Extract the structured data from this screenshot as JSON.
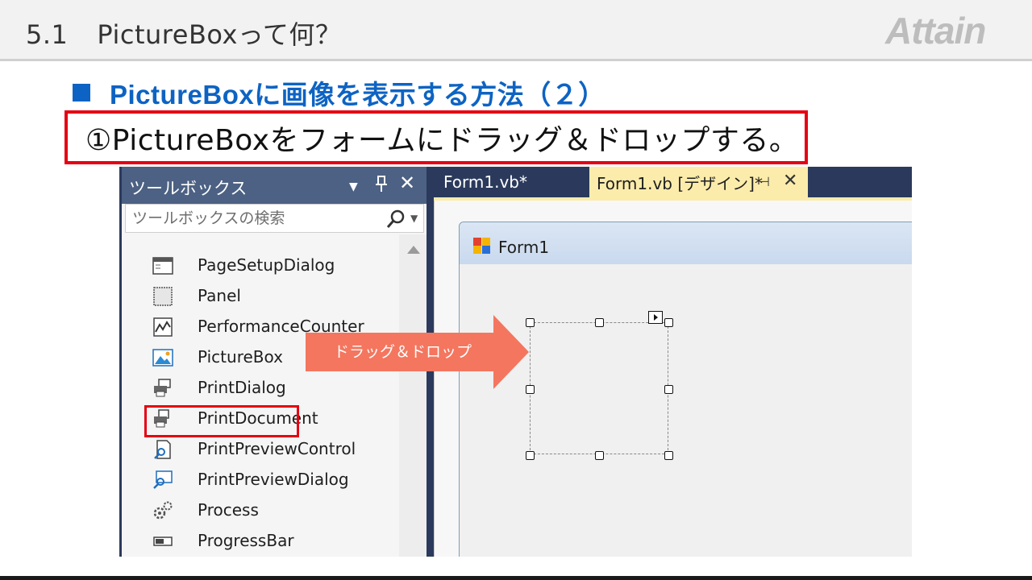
{
  "slide": {
    "number": "5.1",
    "title": "PictureBoxって何？",
    "logo_text": "Attain"
  },
  "section": {
    "heading": "PictureBoxに画像を表示する方法（２）"
  },
  "step": {
    "text": "①PictureBoxをフォームにドラッグ＆ドロップする。"
  },
  "toolbox": {
    "title": "ツールボックス",
    "search_placeholder": "ツールボックスの検索",
    "items": [
      {
        "label": "PageSetupDialog",
        "icon": "page-setup-icon"
      },
      {
        "label": "Panel",
        "icon": "panel-icon"
      },
      {
        "label": "PerformanceCounter",
        "icon": "performance-counter-icon"
      },
      {
        "label": "PictureBox",
        "icon": "picturebox-icon"
      },
      {
        "label": "PrintDialog",
        "icon": "print-dialog-icon"
      },
      {
        "label": "PrintDocument",
        "icon": "print-document-icon"
      },
      {
        "label": "PrintPreviewControl",
        "icon": "print-preview-control-icon"
      },
      {
        "label": "PrintPreviewDialog",
        "icon": "print-preview-dialog-icon"
      },
      {
        "label": "Process",
        "icon": "process-icon"
      },
      {
        "label": "ProgressBar",
        "icon": "progressbar-icon"
      }
    ]
  },
  "tabs": {
    "code_tab": "Form1.vb*",
    "design_tab": "Form1.vb [デザイン]*"
  },
  "form": {
    "title": "Form1"
  },
  "annotation": {
    "drag_label": "ドラッグ＆ドロップ"
  },
  "colors": {
    "heading_blue": "#0d63c3",
    "highlight_red": "#e50012",
    "arrow_salmon": "#f4765f",
    "toolbox_header": "#4c6183",
    "active_tab": "#fcecab"
  }
}
